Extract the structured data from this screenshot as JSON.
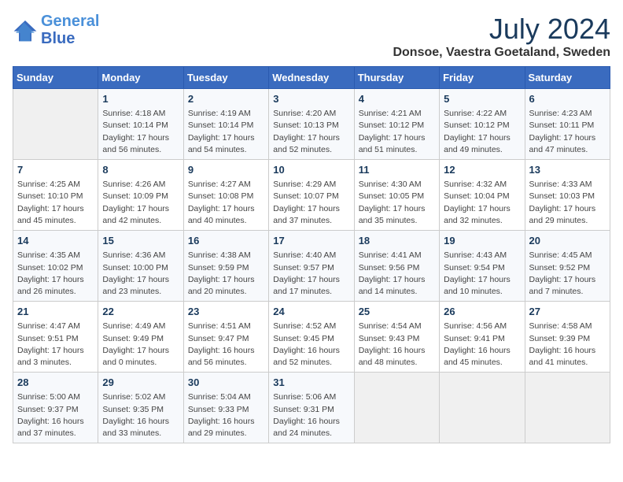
{
  "header": {
    "logo_line1": "General",
    "logo_line2": "Blue",
    "month": "July 2024",
    "location": "Donsoe, Vaestra Goetaland, Sweden"
  },
  "weekdays": [
    "Sunday",
    "Monday",
    "Tuesday",
    "Wednesday",
    "Thursday",
    "Friday",
    "Saturday"
  ],
  "weeks": [
    [
      {
        "day": "",
        "info": ""
      },
      {
        "day": "1",
        "info": "Sunrise: 4:18 AM\nSunset: 10:14 PM\nDaylight: 17 hours\nand 56 minutes."
      },
      {
        "day": "2",
        "info": "Sunrise: 4:19 AM\nSunset: 10:14 PM\nDaylight: 17 hours\nand 54 minutes."
      },
      {
        "day": "3",
        "info": "Sunrise: 4:20 AM\nSunset: 10:13 PM\nDaylight: 17 hours\nand 52 minutes."
      },
      {
        "day": "4",
        "info": "Sunrise: 4:21 AM\nSunset: 10:12 PM\nDaylight: 17 hours\nand 51 minutes."
      },
      {
        "day": "5",
        "info": "Sunrise: 4:22 AM\nSunset: 10:12 PM\nDaylight: 17 hours\nand 49 minutes."
      },
      {
        "day": "6",
        "info": "Sunrise: 4:23 AM\nSunset: 10:11 PM\nDaylight: 17 hours\nand 47 minutes."
      }
    ],
    [
      {
        "day": "7",
        "info": "Sunrise: 4:25 AM\nSunset: 10:10 PM\nDaylight: 17 hours\nand 45 minutes."
      },
      {
        "day": "8",
        "info": "Sunrise: 4:26 AM\nSunset: 10:09 PM\nDaylight: 17 hours\nand 42 minutes."
      },
      {
        "day": "9",
        "info": "Sunrise: 4:27 AM\nSunset: 10:08 PM\nDaylight: 17 hours\nand 40 minutes."
      },
      {
        "day": "10",
        "info": "Sunrise: 4:29 AM\nSunset: 10:07 PM\nDaylight: 17 hours\nand 37 minutes."
      },
      {
        "day": "11",
        "info": "Sunrise: 4:30 AM\nSunset: 10:05 PM\nDaylight: 17 hours\nand 35 minutes."
      },
      {
        "day": "12",
        "info": "Sunrise: 4:32 AM\nSunset: 10:04 PM\nDaylight: 17 hours\nand 32 minutes."
      },
      {
        "day": "13",
        "info": "Sunrise: 4:33 AM\nSunset: 10:03 PM\nDaylight: 17 hours\nand 29 minutes."
      }
    ],
    [
      {
        "day": "14",
        "info": "Sunrise: 4:35 AM\nSunset: 10:02 PM\nDaylight: 17 hours\nand 26 minutes."
      },
      {
        "day": "15",
        "info": "Sunrise: 4:36 AM\nSunset: 10:00 PM\nDaylight: 17 hours\nand 23 minutes."
      },
      {
        "day": "16",
        "info": "Sunrise: 4:38 AM\nSunset: 9:59 PM\nDaylight: 17 hours\nand 20 minutes."
      },
      {
        "day": "17",
        "info": "Sunrise: 4:40 AM\nSunset: 9:57 PM\nDaylight: 17 hours\nand 17 minutes."
      },
      {
        "day": "18",
        "info": "Sunrise: 4:41 AM\nSunset: 9:56 PM\nDaylight: 17 hours\nand 14 minutes."
      },
      {
        "day": "19",
        "info": "Sunrise: 4:43 AM\nSunset: 9:54 PM\nDaylight: 17 hours\nand 10 minutes."
      },
      {
        "day": "20",
        "info": "Sunrise: 4:45 AM\nSunset: 9:52 PM\nDaylight: 17 hours\nand 7 minutes."
      }
    ],
    [
      {
        "day": "21",
        "info": "Sunrise: 4:47 AM\nSunset: 9:51 PM\nDaylight: 17 hours\nand 3 minutes."
      },
      {
        "day": "22",
        "info": "Sunrise: 4:49 AM\nSunset: 9:49 PM\nDaylight: 17 hours\nand 0 minutes."
      },
      {
        "day": "23",
        "info": "Sunrise: 4:51 AM\nSunset: 9:47 PM\nDaylight: 16 hours\nand 56 minutes."
      },
      {
        "day": "24",
        "info": "Sunrise: 4:52 AM\nSunset: 9:45 PM\nDaylight: 16 hours\nand 52 minutes."
      },
      {
        "day": "25",
        "info": "Sunrise: 4:54 AM\nSunset: 9:43 PM\nDaylight: 16 hours\nand 48 minutes."
      },
      {
        "day": "26",
        "info": "Sunrise: 4:56 AM\nSunset: 9:41 PM\nDaylight: 16 hours\nand 45 minutes."
      },
      {
        "day": "27",
        "info": "Sunrise: 4:58 AM\nSunset: 9:39 PM\nDaylight: 16 hours\nand 41 minutes."
      }
    ],
    [
      {
        "day": "28",
        "info": "Sunrise: 5:00 AM\nSunset: 9:37 PM\nDaylight: 16 hours\nand 37 minutes."
      },
      {
        "day": "29",
        "info": "Sunrise: 5:02 AM\nSunset: 9:35 PM\nDaylight: 16 hours\nand 33 minutes."
      },
      {
        "day": "30",
        "info": "Sunrise: 5:04 AM\nSunset: 9:33 PM\nDaylight: 16 hours\nand 29 minutes."
      },
      {
        "day": "31",
        "info": "Sunrise: 5:06 AM\nSunset: 9:31 PM\nDaylight: 16 hours\nand 24 minutes."
      },
      {
        "day": "",
        "info": ""
      },
      {
        "day": "",
        "info": ""
      },
      {
        "day": "",
        "info": ""
      }
    ]
  ]
}
